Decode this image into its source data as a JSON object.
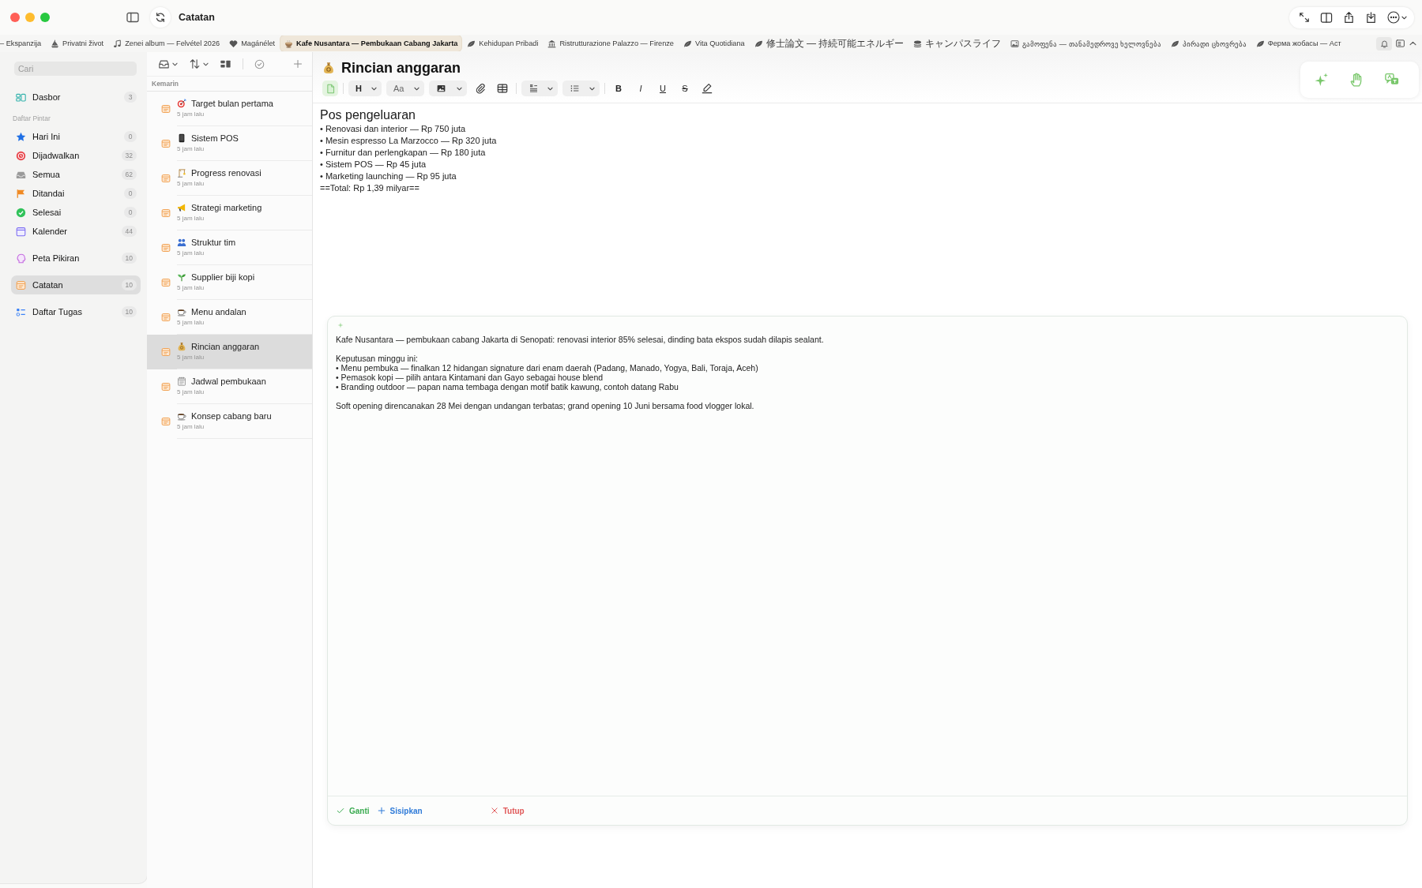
{
  "window": {
    "title": "Catatan"
  },
  "tabs": [
    {
      "label": "– Ekspanzija",
      "kind": "plain",
      "selected": false
    },
    {
      "label": "Privatni život",
      "kind": "sailboat",
      "selected": false
    },
    {
      "label": "Zenei album — Felvétel 2026",
      "kind": "music",
      "selected": false
    },
    {
      "label": "Magánélet",
      "kind": "heart",
      "selected": false
    },
    {
      "label": "Kafe Nusantara — Pembukaan Cabang Jakarta",
      "kind": "cup",
      "selected": true
    },
    {
      "label": "Kehidupan Pribadi",
      "kind": "leaf",
      "selected": false
    },
    {
      "label": "Ristrutturazione Palazzo — Firenze",
      "kind": "building",
      "selected": false
    },
    {
      "label": "Vita Quotidiana",
      "kind": "leaf",
      "selected": false
    },
    {
      "label": "修士論文 — 持続可能エネルギー",
      "kind": "leaf",
      "selected": false
    },
    {
      "label": "キャンパスライフ",
      "kind": "stack",
      "selected": false
    },
    {
      "label": "გამოფენა — თანამედროვე ხელოვნება",
      "kind": "picture",
      "selected": false
    },
    {
      "label": "პირადი ცხოვრება",
      "kind": "leaf",
      "selected": false
    },
    {
      "label": "Ферма жобасы — Аст",
      "kind": "leaf",
      "selected": false
    }
  ],
  "sidebar": {
    "search": {
      "placeholder": "Cari"
    },
    "groups": [
      {
        "items": [
          {
            "label": "Dasbor",
            "count": "3",
            "kind": "dashboard",
            "selected": false
          }
        ]
      },
      {
        "heading": "Daftar Pintar",
        "items": [
          {
            "label": "Hari Ini",
            "count": "0",
            "kind": "star",
            "selected": false
          },
          {
            "label": "Dijadwalkan",
            "count": "32",
            "kind": "scheduled",
            "selected": false
          },
          {
            "label": "Semua",
            "count": "62",
            "kind": "tray",
            "selected": false
          },
          {
            "label": "Ditandai",
            "count": "0",
            "kind": "flag",
            "selected": false
          },
          {
            "label": "Selesai",
            "count": "0",
            "kind": "done",
            "selected": false
          },
          {
            "label": "Kalender",
            "count": "44",
            "kind": "calendar",
            "selected": false
          }
        ]
      },
      {
        "items": [
          {
            "label": "Peta Pikiran",
            "count": "10",
            "kind": "mindmap",
            "selected": false
          }
        ]
      },
      {
        "items": [
          {
            "label": "Catatan",
            "count": "10",
            "kind": "note",
            "selected": true
          }
        ]
      },
      {
        "items": [
          {
            "label": "Daftar Tugas",
            "count": "10",
            "kind": "tasks",
            "selected": false
          }
        ]
      }
    ]
  },
  "note_list": {
    "section": "Kemarin",
    "notes": [
      {
        "title": "Target bulan pertama",
        "time": "5 jam lalu",
        "kind": "target",
        "selected": false
      },
      {
        "title": "Sistem POS",
        "time": "5 jam lalu",
        "kind": "phone",
        "selected": false
      },
      {
        "title": "Progress renovasi",
        "time": "5 jam lalu",
        "kind": "crane",
        "selected": false
      },
      {
        "title": "Strategi marketing",
        "time": "5 jam lalu",
        "kind": "megaphone",
        "selected": false
      },
      {
        "title": "Struktur tim",
        "time": "5 jam lalu",
        "kind": "people",
        "selected": false
      },
      {
        "title": "Supplier biji kopi",
        "time": "5 jam lalu",
        "kind": "sprout",
        "selected": false
      },
      {
        "title": "Menu andalan",
        "time": "5 jam lalu",
        "kind": "coffee",
        "selected": false
      },
      {
        "title": "Rincian anggaran",
        "time": "5 jam lalu",
        "kind": "moneybag",
        "selected": true
      },
      {
        "title": "Jadwal pembukaan",
        "time": "5 jam lalu",
        "kind": "notepad",
        "selected": false
      },
      {
        "title": "Konsep cabang baru",
        "time": "5 jam lalu",
        "kind": "coffee",
        "selected": false
      }
    ]
  },
  "editor": {
    "title": "Rincian anggaran",
    "toolbar": [
      {
        "kind": "page"
      },
      {
        "kind": "separator"
      },
      {
        "kind": "heading",
        "label": "H"
      },
      {
        "kind": "font",
        "label": "Aa"
      },
      {
        "kind": "image"
      },
      {
        "kind": "attach"
      },
      {
        "kind": "table"
      },
      {
        "kind": "separator"
      },
      {
        "kind": "paragraph"
      },
      {
        "kind": "list"
      },
      {
        "kind": "separator"
      },
      {
        "kind": "bold",
        "label": "B"
      },
      {
        "kind": "italic",
        "label": "I"
      },
      {
        "kind": "underline",
        "label": "U"
      },
      {
        "kind": "strike",
        "label": "S"
      },
      {
        "kind": "highlight"
      }
    ],
    "heading": "Pos pengeluaran",
    "lines": [
      "• Renovasi dan interior — Rp 750 juta",
      "• Mesin espresso La Marzocco — Rp 320 juta",
      "• Furnitur dan perlengkapan — Rp 180 juta",
      "• Sistem POS — Rp 45 juta",
      "• Marketing launching — Rp 95 juta",
      "==Total: Rp 1,39 milyar=="
    ]
  },
  "ai_panel": {
    "paragraphs": [
      [
        "Kafe Nusantara — pembukaan cabang Jakarta di Senopati: renovasi interior 85% selesai, dinding bata ekspos sudah dilapis sealant."
      ],
      [
        "Keputusan minggu ini:",
        "• Menu pembuka — finalkan 12 hidangan signature dari enam daerah (Padang, Manado, Yogya, Bali, Toraja, Aceh)",
        "• Pemasok kopi — pilih antara Kintamani dan Gayo sebagai house blend",
        "• Branding outdoor — papan nama tembaga dengan motif batik kawung, contoh datang Rabu"
      ],
      [
        "Soft opening direncanakan 28 Mei dengan undangan terbatas; grand opening 10 Juni bersama food vlogger lokal."
      ]
    ],
    "actions": [
      {
        "label": "Ganti",
        "kind": "replace"
      },
      {
        "label": "Sisipkan",
        "kind": "insert"
      },
      {
        "label": "Tutup",
        "kind": "close"
      }
    ]
  }
}
